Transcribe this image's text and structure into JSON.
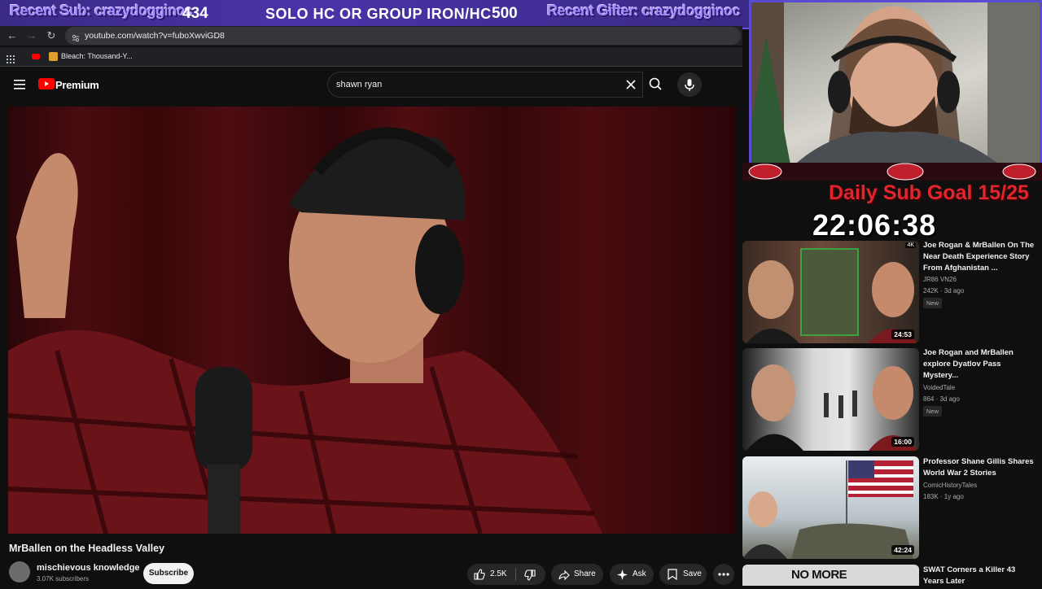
{
  "overlay": {
    "recent_sub": "Recent Sub: crazydogginoc",
    "goal_current": "434",
    "banner": "SOLO HC OR GROUP IRON/HC",
    "goal_target": "500",
    "recent_gifter": "Recent Gifter: crazydogginoc",
    "daily_sub_goal": "Daily Sub Goal 15/25",
    "timer": "22:06:38",
    "accent_color": "#6a4fd8",
    "goal_color": "#e0262c"
  },
  "browser": {
    "url": "youtube.com/watch?v=fuboXwviGD8",
    "bookmark": "Bleach: Thousand-Y..."
  },
  "youtube": {
    "logo_text": "Premium",
    "search_value": "shawn ryan",
    "video": {
      "title": "MrBallen on the Headless Valley",
      "channel": "mischievous knowledge",
      "subscribers": "3.07K subscribers",
      "subscribe_label": "Subscribe",
      "likes": "2.5K",
      "share_label": "Share",
      "ask_label": "Ask",
      "save_label": "Save"
    },
    "recommendations": [
      {
        "title": "Joe Rogan & MrBallen On The Near Death Experience Story From Afghanistan ...",
        "channel": "JR86 VN26",
        "meta": "242K · 3d ago",
        "badge": "New",
        "duration": "24:53",
        "hd": "4K"
      },
      {
        "title": "Joe Rogan and MrBallen explore Dyatlov Pass Mystery...",
        "channel": "VoidedTale",
        "meta": "864 · 3d ago",
        "badge": "New",
        "duration": "16:00"
      },
      {
        "title": "Professor Shane Gillis Shares World War 2 Stories",
        "channel": "ComicHistoryTales",
        "meta": "183K · 1y ago",
        "duration": "42:24"
      },
      {
        "title": "SWAT Corners a Killer 43 Years Later",
        "thumb_text": "NO MORE"
      }
    ]
  }
}
